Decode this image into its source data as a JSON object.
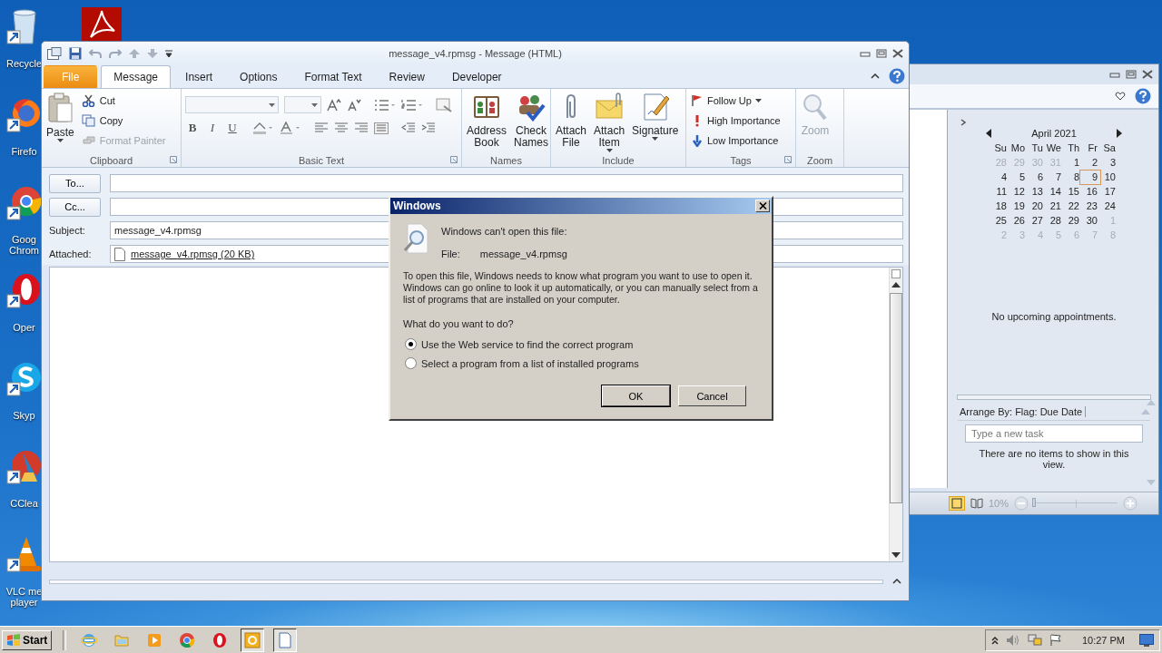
{
  "desktop": {
    "icons": [
      {
        "kind": "recycle",
        "lines": [
          "Recycle"
        ]
      },
      {
        "kind": "firefox",
        "lines": [
          "Firefo"
        ]
      },
      {
        "kind": "chrome",
        "lines": [
          "Goog",
          "Chrom"
        ]
      },
      {
        "kind": "opera",
        "lines": [
          "Oper"
        ]
      },
      {
        "kind": "skype",
        "lines": [
          "Skyp"
        ]
      },
      {
        "kind": "ccleaner",
        "lines": [
          "CClea"
        ]
      },
      {
        "kind": "vlc",
        "lines": [
          "VLC me",
          "player"
        ]
      }
    ]
  },
  "message_window": {
    "title": "message_v4.rpmsg - Message (HTML)",
    "tabs": [
      {
        "label": "File",
        "kind": "file",
        "selected": false
      },
      {
        "label": "Message",
        "kind": "tab",
        "selected": true
      },
      {
        "label": "Insert",
        "kind": "tab",
        "selected": false
      },
      {
        "label": "Options",
        "kind": "tab",
        "selected": false
      },
      {
        "label": "Format Text",
        "kind": "tab",
        "selected": false
      },
      {
        "label": "Review",
        "kind": "tab",
        "selected": false
      },
      {
        "label": "Developer",
        "kind": "tab",
        "selected": false
      }
    ],
    "ribbon": {
      "clipboard": {
        "label": "Clipboard",
        "paste": "Paste",
        "items": [
          {
            "kind": "cut",
            "label": "Cut",
            "disabled": false
          },
          {
            "kind": "copy",
            "label": "Copy",
            "disabled": false
          },
          {
            "kind": "painter",
            "label": "Format Painter",
            "disabled": true
          }
        ]
      },
      "basic_text": {
        "label": "Basic Text",
        "letters": [
          "B",
          "I",
          "U"
        ]
      },
      "names": {
        "label": "Names",
        "buttons": [
          {
            "kind": "book",
            "lines": [
              "Address",
              "Book"
            ],
            "dropdown": false,
            "disabled": false
          },
          {
            "kind": "check",
            "lines": [
              "Check",
              "Names"
            ],
            "dropdown": false,
            "disabled": false
          }
        ]
      },
      "include": {
        "label": "Include",
        "buttons": [
          {
            "kind": "clip",
            "lines": [
              "Attach",
              "File"
            ],
            "dropdown": false,
            "disabled": false
          },
          {
            "kind": "envelope",
            "lines": [
              "Attach",
              "Item"
            ],
            "dropdown": true,
            "disabled": false
          },
          {
            "kind": "pen",
            "lines": [
              "Signature"
            ],
            "dropdown": true,
            "disabled": false
          }
        ]
      },
      "tags": {
        "label": "Tags",
        "items": [
          {
            "kind": "flag",
            "label": "Follow Up",
            "dropdown": true
          },
          {
            "kind": "high",
            "label": "High Importance",
            "dropdown": false
          },
          {
            "kind": "low",
            "label": "Low Importance",
            "dropdown": false
          }
        ]
      },
      "zoom": {
        "label": "Zoom",
        "buttons": [
          {
            "kind": "magnifier",
            "lines": [
              "Zoom"
            ],
            "dropdown": false,
            "disabled": true
          }
        ]
      }
    },
    "form": {
      "to_button": "To...",
      "cc_button": "Cc...",
      "subject_label": "Subject:",
      "subject_value": "message_v4.rpmsg",
      "attached_label": "Attached:",
      "attachment": "message_v4.rpmsg (20 KB)"
    }
  },
  "dialog": {
    "title": "Windows",
    "heading": "Windows can't open this file:",
    "file_label": "File:",
    "file_name": "message_v4.rpmsg",
    "description": "To open this file, Windows needs to know what program you want to use to open it. Windows can go online to look it up automatically, or you can manually select from a list of programs that are installed on your computer.",
    "question": "What do you want to do?",
    "options": [
      {
        "label": "Use the Web service to find the correct program",
        "selected": true
      },
      {
        "label": "Select a program from a list of installed programs",
        "selected": false
      }
    ],
    "buttons": [
      {
        "label": "OK",
        "default": true
      },
      {
        "label": "Cancel",
        "default": false
      }
    ]
  },
  "main_window": {
    "calendar": {
      "month": "April 2021",
      "weekdays": [
        "Su",
        "Mo",
        "Tu",
        "We",
        "Th",
        "Fr",
        "Sa"
      ],
      "weeks": [
        [
          {
            "d": "28",
            "other": true,
            "today": false
          },
          {
            "d": "29",
            "other": true,
            "today": false
          },
          {
            "d": "30",
            "other": true,
            "today": false
          },
          {
            "d": "31",
            "other": true,
            "today": false
          },
          {
            "d": "1",
            "other": false,
            "today": false
          },
          {
            "d": "2",
            "other": false,
            "today": false
          },
          {
            "d": "3",
            "other": false,
            "today": false
          }
        ],
        [
          {
            "d": "4",
            "other": false,
            "today": false
          },
          {
            "d": "5",
            "other": false,
            "today": false
          },
          {
            "d": "6",
            "other": false,
            "today": false
          },
          {
            "d": "7",
            "other": false,
            "today": false
          },
          {
            "d": "8",
            "other": false,
            "today": false
          },
          {
            "d": "9",
            "other": false,
            "today": true
          },
          {
            "d": "10",
            "other": false,
            "today": false
          }
        ],
        [
          {
            "d": "11",
            "other": false,
            "today": false
          },
          {
            "d": "12",
            "other": false,
            "today": false
          },
          {
            "d": "13",
            "other": false,
            "today": false
          },
          {
            "d": "14",
            "other": false,
            "today": false
          },
          {
            "d": "15",
            "other": false,
            "today": false
          },
          {
            "d": "16",
            "other": false,
            "today": false
          },
          {
            "d": "17",
            "other": false,
            "today": false
          }
        ],
        [
          {
            "d": "18",
            "other": false,
            "today": false
          },
          {
            "d": "19",
            "other": false,
            "today": false
          },
          {
            "d": "20",
            "other": false,
            "today": false
          },
          {
            "d": "21",
            "other": false,
            "today": false
          },
          {
            "d": "22",
            "other": false,
            "today": false
          },
          {
            "d": "23",
            "other": false,
            "today": false
          },
          {
            "d": "24",
            "other": false,
            "today": false
          }
        ],
        [
          {
            "d": "25",
            "other": false,
            "today": false
          },
          {
            "d": "26",
            "other": false,
            "today": false
          },
          {
            "d": "27",
            "other": false,
            "today": false
          },
          {
            "d": "28",
            "other": false,
            "today": false
          },
          {
            "d": "29",
            "other": false,
            "today": false
          },
          {
            "d": "30",
            "other": false,
            "today": false
          },
          {
            "d": "1",
            "other": true,
            "today": false
          }
        ],
        [
          {
            "d": "2",
            "other": true,
            "today": false
          },
          {
            "d": "3",
            "other": true,
            "today": false
          },
          {
            "d": "4",
            "other": true,
            "today": false
          },
          {
            "d": "5",
            "other": true,
            "today": false
          },
          {
            "d": "6",
            "other": true,
            "today": false
          },
          {
            "d": "7",
            "other": true,
            "today": false
          },
          {
            "d": "8",
            "other": true,
            "today": false
          }
        ]
      ]
    },
    "appointments_note": "No upcoming appointments.",
    "arrange_by": "Arrange By: Flag: Due Date",
    "task_input": {
      "placeholder": "Type a new task"
    },
    "empty_note": "There are no items to show in this view.",
    "zoom_reading": "10%",
    "zoom_slider": {
      "level": 0
    }
  },
  "taskbar": {
    "start": "Start",
    "items": [
      {
        "kind": "ie",
        "selected": false
      },
      {
        "kind": "folder",
        "selected": false
      },
      {
        "kind": "media",
        "selected": false
      },
      {
        "kind": "chrome",
        "selected": false
      },
      {
        "kind": "opera",
        "selected": false
      },
      {
        "kind": "outlook",
        "selected": true
      },
      {
        "kind": "page",
        "selected": true
      }
    ],
    "clock": "10:27 PM"
  }
}
